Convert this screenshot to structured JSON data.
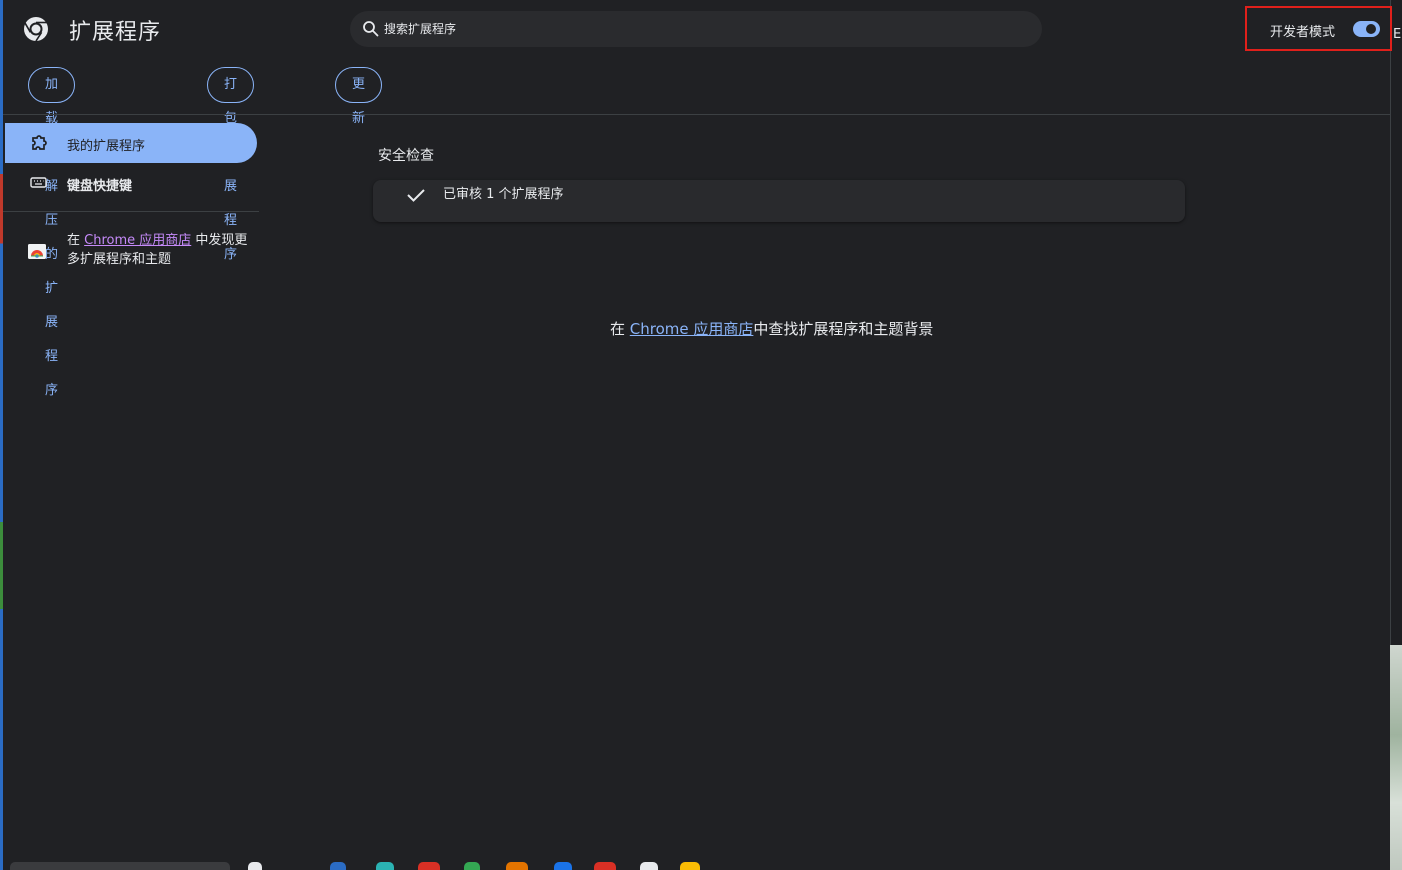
{
  "header": {
    "title": "扩展程序",
    "search_placeholder": "搜索扩展程序",
    "dev_mode_label": "开发者模式",
    "dev_mode_on": true
  },
  "toolbar": {
    "load_unpacked": "加载已解压的扩展程序",
    "pack": "打包扩展程序",
    "update": "更新"
  },
  "sidebar": {
    "items": [
      {
        "label": "我的扩展程序",
        "icon": "puzzle-icon",
        "active": true
      },
      {
        "label": "键盘快捷键",
        "icon": "keyboard-icon",
        "active": false
      }
    ],
    "store_prefix": "在 ",
    "store_link": "Chrome 应用商店",
    "store_suffix": " 中发现更多扩展程序和主题"
  },
  "main": {
    "safety_title": "安全检查",
    "safety_status": "已审核 1 个扩展程序",
    "find_prefix": "在 ",
    "find_link": "Chrome 应用商店",
    "find_suffix": "中查找扩展程序和主题背景"
  },
  "edge_letter": "E",
  "colors": {
    "background": "#202124",
    "accent": "#8ab4f8",
    "link_visited": "#c58af9",
    "highlight_border": "#e0201b"
  }
}
